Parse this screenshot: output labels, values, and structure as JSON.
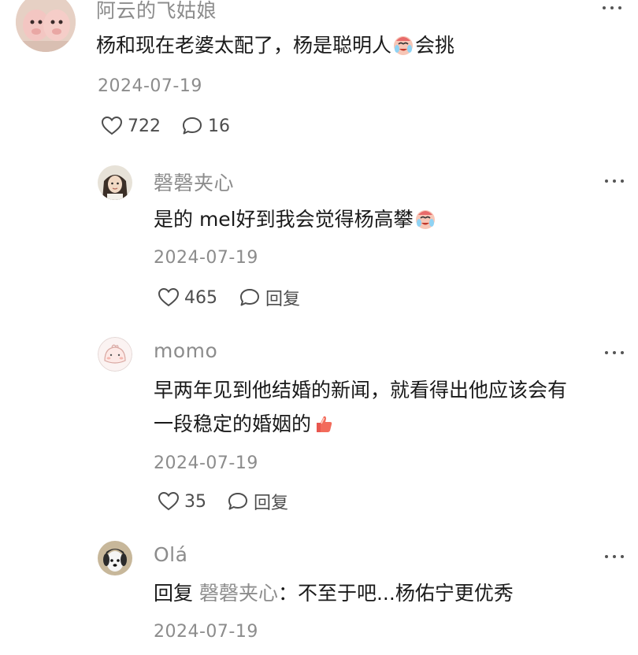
{
  "comments": [
    {
      "username": "阿云的飞姑娘",
      "text_before": "杨和现在老婆太配了，杨是聪明人",
      "emoji": "crying-laugh-emoji",
      "text_after": "会挑",
      "date": "2024-07-19",
      "likes": "722",
      "replies": "16"
    },
    {
      "username": "磬磬夹心",
      "text_before": "是的 mel好到我会觉得杨高攀",
      "emoji": "crying-laugh-emoji",
      "date": "2024-07-19",
      "likes": "465",
      "reply_label": "回复"
    },
    {
      "username": "momo",
      "text_line1": "早两年见到他结婚的新闻，就看得出他应该会有",
      "text_line2": "一段稳定的婚姻的",
      "emoji": "thumbs-up-emoji",
      "date": "2024-07-19",
      "likes": "35",
      "reply_label": "回复"
    },
    {
      "username": "Olá",
      "reply_prefix": "回复",
      "reply_to": "磬磬夹心",
      "text": "：不至于吧...杨佑宁更优秀",
      "date": "2024-07-19"
    }
  ],
  "colors": {
    "username": "#8c8c8c",
    "text": "#1a1a1a",
    "meta": "#8c8c8c",
    "icon": "#4d4d4d"
  },
  "icons": {
    "like": "heart-outline-icon",
    "comment": "speech-bubble-icon",
    "more": "more-dots-icon"
  }
}
